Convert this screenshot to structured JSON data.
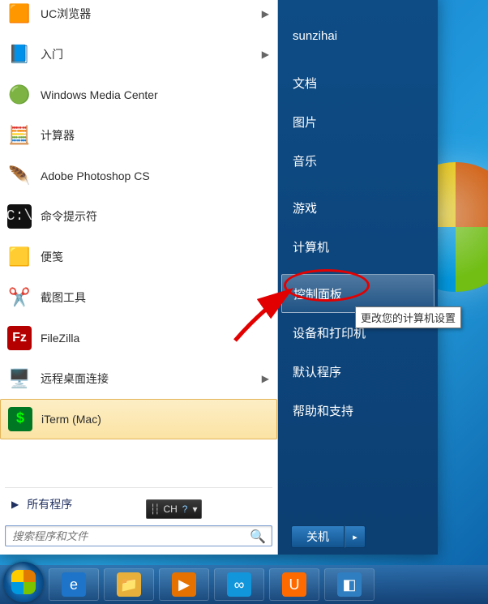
{
  "user": {
    "name": "sunzihai"
  },
  "left_pane": {
    "programs": [
      {
        "label": "UC浏览器",
        "icon_name": "uc-browser-icon",
        "icon": "🟧",
        "has_submenu": true
      },
      {
        "label": "入门",
        "icon_name": "getting-started-icon",
        "icon": "📘",
        "has_submenu": true
      },
      {
        "label": "Windows Media Center",
        "icon_name": "media-center-icon",
        "icon": "🟢",
        "has_submenu": false
      },
      {
        "label": "计算器",
        "icon_name": "calculator-icon",
        "icon": "🧮",
        "has_submenu": false
      },
      {
        "label": "Adobe Photoshop CS",
        "icon_name": "photoshop-icon",
        "icon": "🪶",
        "has_submenu": false
      },
      {
        "label": "命令提示符",
        "icon_name": "cmd-icon",
        "icon": "⬛",
        "has_submenu": false
      },
      {
        "label": "便笺",
        "icon_name": "sticky-notes-icon",
        "icon": "🟨",
        "has_submenu": false
      },
      {
        "label": "截图工具",
        "icon_name": "snipping-tool-icon",
        "icon": "✂️",
        "has_submenu": false
      },
      {
        "label": "FileZilla",
        "icon_name": "filezilla-icon",
        "icon": "Fz",
        "has_submenu": false
      },
      {
        "label": "远程桌面连接",
        "icon_name": "remote-desktop-icon",
        "icon": "🖥️",
        "has_submenu": true
      },
      {
        "label": "iTerm (Mac)",
        "icon_name": "iterm-icon",
        "icon": "$",
        "has_submenu": false,
        "selected": true
      }
    ],
    "all_programs_label": "所有程序",
    "search_placeholder": "搜索程序和文件"
  },
  "ime": {
    "lang": "CH"
  },
  "right_pane": {
    "items": [
      {
        "label": "文档"
      },
      {
        "label": "图片"
      },
      {
        "label": "音乐"
      },
      {
        "label": "游戏"
      },
      {
        "label": "计算机"
      },
      {
        "label": "控制面板",
        "hover": true
      },
      {
        "label": "设备和打印机"
      },
      {
        "label": "默认程序"
      },
      {
        "label": "帮助和支持"
      }
    ],
    "tooltip": "更改您的计算机设置",
    "shutdown_label": "关机"
  },
  "taskbar": {
    "buttons": [
      {
        "name": "ie-icon",
        "glyph": "e",
        "bg": "#1d74c8"
      },
      {
        "name": "explorer-icon",
        "glyph": "📁",
        "bg": "#e8b03a"
      },
      {
        "name": "media-player-icon",
        "glyph": "▶",
        "bg": "#e57200"
      },
      {
        "name": "baidu-pan-icon",
        "glyph": "∞",
        "bg": "#1296db"
      },
      {
        "name": "uc-browser-icon",
        "glyph": "U",
        "bg": "#ff6a00"
      },
      {
        "name": "app-icon",
        "glyph": "◧",
        "bg": "#2f7ec2"
      }
    ]
  },
  "colors": {
    "annotation_red": "#e30000"
  }
}
